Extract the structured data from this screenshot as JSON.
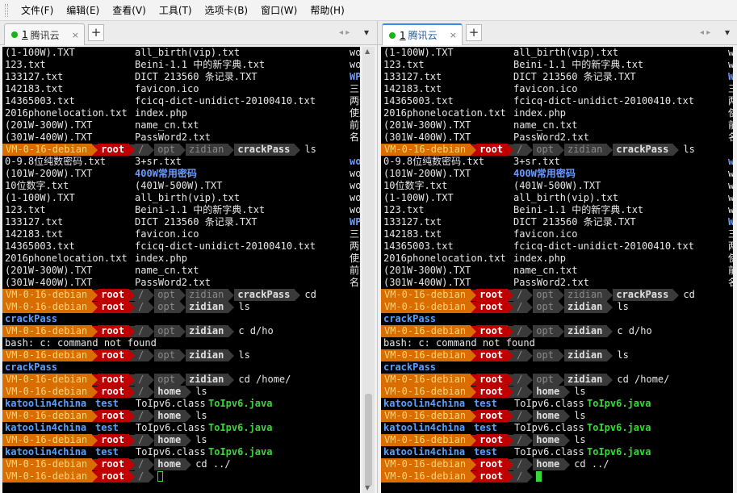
{
  "menu": [
    "文件(F)",
    "编辑(E)",
    "查看(V)",
    "工具(T)",
    "选项卡(B)",
    "窗口(W)",
    "帮助(H)"
  ],
  "left_tab": {
    "num": "1",
    "title": "腾讯云",
    "close": "×"
  },
  "right_tab": {
    "num": "1",
    "title": "腾讯云",
    "close": "×"
  },
  "add_tab": "+",
  "nav_left": "◂ ▸",
  "nav_right": "▾",
  "pin": "◂ ▸",
  "terminal_lines": [
    {
      "t": "files",
      "c": [
        "(1-100W).TXT",
        "all_birth(vip).txt",
        "wordl"
      ]
    },
    {
      "t": "files",
      "c": [
        "123.txt",
        "Beini-1.1 中的新字典.txt",
        "wordl"
      ]
    },
    {
      "t": "files",
      "c": [
        "133127.txt",
        "DICT 213560 条记录.TXT",
        "WPA英"
      ],
      "hl3": true
    },
    {
      "t": "files",
      "c": [
        "142183.txt",
        "favicon.ico",
        "三字"
      ]
    },
    {
      "t": "files",
      "c": [
        "14365003.txt",
        "fcicq-dict-unidict-20100410.txt",
        "两个"
      ]
    },
    {
      "t": "files",
      "c": [
        "2016phonelocation.txt",
        "index.php",
        "使用"
      ]
    },
    {
      "t": "files",
      "c": [
        "(201W-300W).TXT",
        "name_cn.txt",
        "前面"
      ]
    },
    {
      "t": "files",
      "c": [
        "(301W-400W).TXT",
        "PassWord2.txt",
        "名字"
      ]
    },
    {
      "t": "prompt",
      "host": "VM-0-16-debian",
      "user": "root",
      "dirs": [
        "/",
        "opt",
        "zidian",
        "crackPass"
      ],
      "cmd": "ls"
    },
    {
      "t": "files",
      "c": [
        "0-9.8位纯数密码.txt",
        "3+sr.txt",
        "wordl"
      ],
      "hl3": true
    },
    {
      "t": "files",
      "c": [
        "(101W-200W).TXT",
        "400W常用密码",
        "wordl"
      ],
      "hl2": true
    },
    {
      "t": "files",
      "c": [
        "10位数字.txt",
        "(401W-500W).TXT",
        "wordl"
      ]
    },
    {
      "t": "files",
      "c": [
        "(1-100W).TXT",
        "all_birth(vip).txt",
        "wordl"
      ]
    },
    {
      "t": "files",
      "c": [
        "123.txt",
        "Beini-1.1 中的新字典.txt",
        "wordl"
      ]
    },
    {
      "t": "files",
      "c": [
        "133127.txt",
        "DICT 213560 条记录.TXT",
        "WPA英"
      ],
      "hl3": true
    },
    {
      "t": "files",
      "c": [
        "142183.txt",
        "favicon.ico",
        "三字"
      ]
    },
    {
      "t": "files",
      "c": [
        "14365003.txt",
        "fcicq-dict-unidict-20100410.txt",
        "两个"
      ]
    },
    {
      "t": "files",
      "c": [
        "2016phonelocation.txt",
        "index.php",
        "使用"
      ]
    },
    {
      "t": "files",
      "c": [
        "(201W-300W).TXT",
        "name_cn.txt",
        "前面"
      ]
    },
    {
      "t": "files",
      "c": [
        "(301W-400W).TXT",
        "PassWord2.txt",
        "名字"
      ]
    },
    {
      "t": "prompt",
      "host": "VM-0-16-debian",
      "user": "root",
      "dirs": [
        "/",
        "opt",
        "zidian",
        "crackPass"
      ],
      "cmd": "cd"
    },
    {
      "t": "prompt",
      "host": "VM-0-16-debian",
      "user": "root",
      "dirs": [
        "/",
        "opt",
        "zidian"
      ],
      "cmd": "ls"
    },
    {
      "t": "dir",
      "text": "crackPass"
    },
    {
      "t": "prompt",
      "host": "VM-0-16-debian",
      "user": "root",
      "dirs": [
        "/",
        "opt",
        "zidian"
      ],
      "cmd": "c d/ho"
    },
    {
      "t": "plain",
      "text": "bash: c: command not found"
    },
    {
      "t": "prompt",
      "host": "VM-0-16-debian",
      "user": "root",
      "dirs": [
        "/",
        "opt",
        "zidian"
      ],
      "cmd": "ls"
    },
    {
      "t": "dir",
      "text": "crackPass"
    },
    {
      "t": "prompt",
      "host": "VM-0-16-debian",
      "user": "root",
      "dirs": [
        "/",
        "opt",
        "zidian"
      ],
      "cmd": "cd /home/"
    },
    {
      "t": "prompt",
      "host": "VM-0-16-debian",
      "user": "root",
      "dirs": [
        "/",
        "home"
      ],
      "cmd": "ls"
    },
    {
      "t": "home",
      "a": "katoolin4china",
      "b": "test",
      "c": "ToIpv6.class",
      "d": "ToIpv6.java"
    },
    {
      "t": "prompt",
      "host": "VM-0-16-debian",
      "user": "root",
      "dirs": [
        "/",
        "home"
      ],
      "cmd": "ls"
    },
    {
      "t": "home",
      "a": "katoolin4china",
      "b": "test",
      "c": "ToIpv6.class",
      "d": "ToIpv6.java"
    },
    {
      "t": "prompt",
      "host": "VM-0-16-debian",
      "user": "root",
      "dirs": [
        "/",
        "home"
      ],
      "cmd": "ls"
    },
    {
      "t": "home",
      "a": "katoolin4china",
      "b": "test",
      "c": "ToIpv6.class",
      "d": "ToIpv6.java"
    },
    {
      "t": "prompt",
      "host": "VM-0-16-debian",
      "user": "root",
      "dirs": [
        "/",
        "home"
      ],
      "cmd": "cd ../"
    },
    {
      "t": "prompt",
      "host": "VM-0-16-debian",
      "user": "root",
      "dirs": [
        "/"
      ],
      "cmd": "",
      "cursor": true
    }
  ],
  "colors": {
    "host_bg": "#d96d00",
    "user_bg": "#c00000",
    "dir_bg": "#3a3a3a",
    "cursor_left": "#38d838",
    "cursor_right": "#38d838"
  }
}
